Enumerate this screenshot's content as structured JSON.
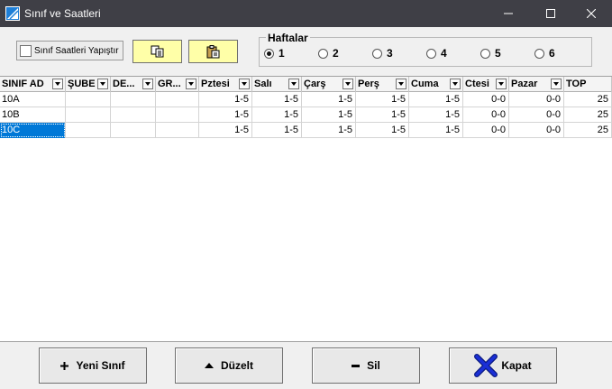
{
  "window": {
    "title": "Sınıf ve Saatleri"
  },
  "toolbar": {
    "paste_label": "Sınıf Saatleri Yapıştır"
  },
  "weeks": {
    "legend": "Haftalar",
    "selected": "1",
    "options": [
      "1",
      "2",
      "3",
      "4",
      "5",
      "6"
    ]
  },
  "grid": {
    "columns": [
      "SINIF AD",
      "ŞUBE",
      "DE...",
      "GR...",
      "Pztesi",
      "Salı",
      "Çarş",
      "Perş",
      "Cuma",
      "Ctesi",
      "Pazar",
      "TOP"
    ],
    "rows": [
      [
        "10A",
        "",
        "",
        "",
        "1-5",
        "1-5",
        "1-5",
        "1-5",
        "1-5",
        "0-0",
        "0-0",
        "25"
      ],
      [
        "10B",
        "",
        "",
        "",
        "1-5",
        "1-5",
        "1-5",
        "1-5",
        "1-5",
        "0-0",
        "0-0",
        "25"
      ],
      [
        "10C",
        "",
        "",
        "",
        "1-5",
        "1-5",
        "1-5",
        "1-5",
        "1-5",
        "0-0",
        "0-0",
        "25"
      ]
    ],
    "selected_row": 2
  },
  "buttons": {
    "new_class": "Yeni Sınıf",
    "edit": "Düzelt",
    "delete": "Sil",
    "close": "Kapat"
  },
  "colors": {
    "titlebar": "#3f3f46",
    "selection": "#0078d7",
    "yellow_button": "#ffffa8",
    "close_x": "#1a2fd6"
  }
}
